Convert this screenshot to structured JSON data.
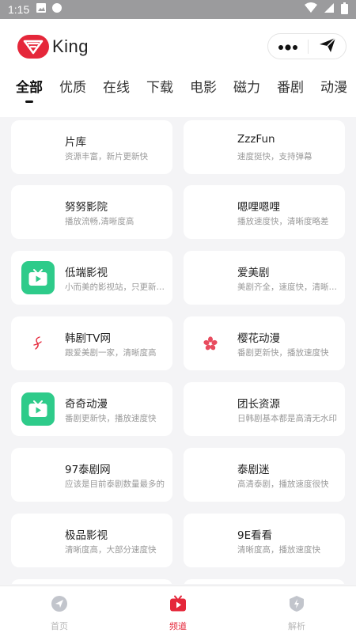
{
  "status": {
    "time": "1:15"
  },
  "app": {
    "name": "King"
  },
  "tabs": [
    {
      "label": "全部",
      "active": true
    },
    {
      "label": "优质",
      "active": false
    },
    {
      "label": "在线",
      "active": false
    },
    {
      "label": "下载",
      "active": false
    },
    {
      "label": "电影",
      "active": false
    },
    {
      "label": "磁力",
      "active": false
    },
    {
      "label": "番剧",
      "active": false
    },
    {
      "label": "动漫",
      "active": false
    }
  ],
  "cards": [
    {
      "title": "片库",
      "desc": "资源丰富，新片更新快",
      "icon": "blank"
    },
    {
      "title": "ZzzFun",
      "desc": "速度挺快，支持弹幕",
      "icon": "blank"
    },
    {
      "title": "努努影院",
      "desc": "播放流畅,清晰度高",
      "icon": "blank"
    },
    {
      "title": "嗯哩嗯哩",
      "desc": "播放速度快，清晰度略差",
      "icon": "blank"
    },
    {
      "title": "低端影视",
      "desc": "小而美的影视站，只更新高分影视",
      "icon": "tv-icon"
    },
    {
      "title": "爱美剧",
      "desc": "美剧齐全，速度快，清晰度高",
      "icon": "blank"
    },
    {
      "title": "韩剧TV网",
      "desc": "跟爱美剧一家，清晰度高",
      "icon": "script-logo-icon"
    },
    {
      "title": "樱花动漫",
      "desc": "番剧更新快，播放速度快",
      "icon": "sakura-icon"
    },
    {
      "title": "奇奇动漫",
      "desc": "番剧更新快，播放速度快",
      "icon": "tv-icon"
    },
    {
      "title": "团长资源",
      "desc": "日韩剧基本都是高清无水印",
      "icon": "blank"
    },
    {
      "title": "97泰剧网",
      "desc": "应该是目前泰剧数量最多的",
      "icon": "blank"
    },
    {
      "title": "泰剧迷",
      "desc": "高清泰剧，播放速度很快",
      "icon": "blank"
    },
    {
      "title": "极品影视",
      "desc": "清晰度高，大部分速度快",
      "icon": "blank"
    },
    {
      "title": "9E看看",
      "desc": "清晰度高，播放速度快",
      "icon": "blank"
    },
    {
      "title": "",
      "desc": "",
      "icon": "blank"
    },
    {
      "title": "",
      "desc": "",
      "icon": "blank"
    }
  ],
  "nav": [
    {
      "label": "首页",
      "icon": "compass-icon",
      "active": false
    },
    {
      "label": "频道",
      "icon": "tv-icon",
      "active": true
    },
    {
      "label": "解析",
      "icon": "shield-bolt-icon",
      "active": false
    }
  ],
  "colors": {
    "accent": "#e5273a",
    "green": "#2ecb8a",
    "background": "#f4f4f6"
  }
}
